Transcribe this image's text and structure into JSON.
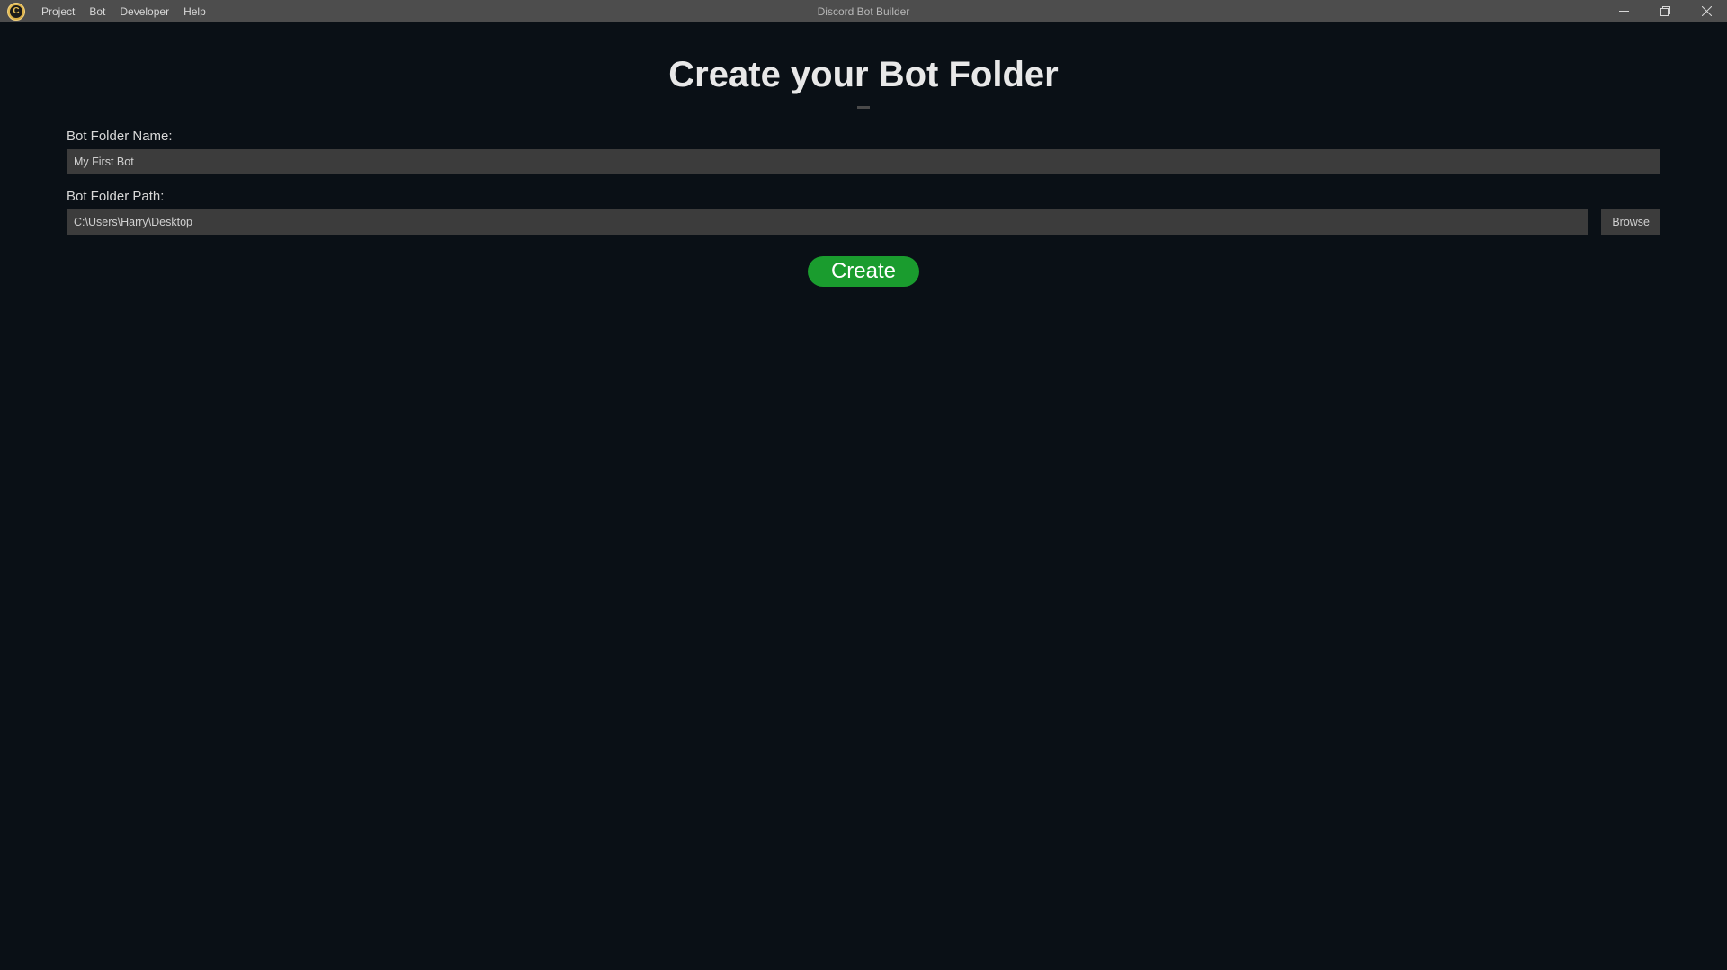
{
  "titlebar": {
    "app_title": "Discord Bot Builder",
    "menu": {
      "project": "Project",
      "bot": "Bot",
      "developer": "Developer",
      "help": "Help"
    }
  },
  "content": {
    "page_title": "Create your Bot Folder",
    "folder_name": {
      "label": "Bot Folder Name:",
      "value": "My First Bot"
    },
    "folder_path": {
      "label": "Bot Folder Path:",
      "value": "C:\\Users\\Harry\\Desktop",
      "browse_label": "Browse"
    },
    "create_button": "Create"
  }
}
